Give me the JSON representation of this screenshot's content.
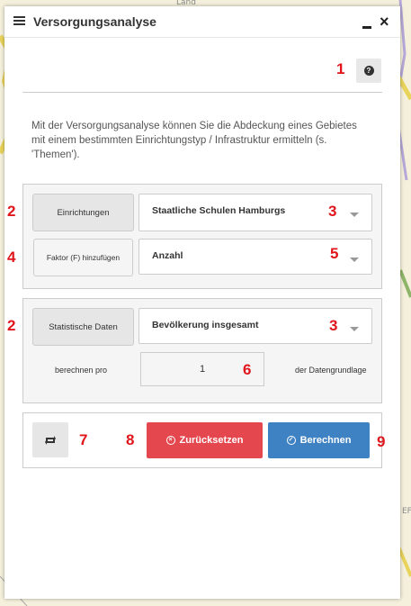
{
  "window": {
    "title": "Versorgungsanalyse",
    "intro_text": "Mit der Versorgungsanalyse können Sie die Abdeckung eines Gebietes mit einem bestimmten Einrichtungstyp / Infrastruktur ermitteln (s. 'Themen')."
  },
  "map": {
    "label_top": "Land",
    "label_right": "EF"
  },
  "section1": {
    "einrichtungen_button": "Einrichtungen",
    "einrichtungen_value": "Staatliche Schulen Hamburgs",
    "faktor_button": "Faktor (F) hinzufügen",
    "faktor_value": "Anzahl"
  },
  "section2": {
    "statistische_button": "Statistische Daten",
    "statistische_value": "Bevölkerung insgesamt",
    "berechnen_pro_label": "berechnen pro",
    "berechnen_pro_value": "1",
    "datengrundlage_label": "der Datengrundlage"
  },
  "actions": {
    "reset_label": "Zurücksetzen",
    "calculate_label": "Berechnen"
  },
  "annotations": {
    "n1": "1",
    "n2a": "2",
    "n2b": "2",
    "n3a": "3",
    "n3b": "3",
    "n3c": "3",
    "n4": "4",
    "n5": "5",
    "n6": "6",
    "n7": "7",
    "n8": "8",
    "n9": "9"
  },
  "colors": {
    "annotation": "#e0161c",
    "reset_button": "#e4474e",
    "calculate_button": "#3f82c4"
  },
  "icons": {
    "header": "list-icon",
    "help": "question-circle-icon",
    "toggle": "swap-icon",
    "reset": "times-circle-icon",
    "calculate": "check-circle-icon"
  }
}
